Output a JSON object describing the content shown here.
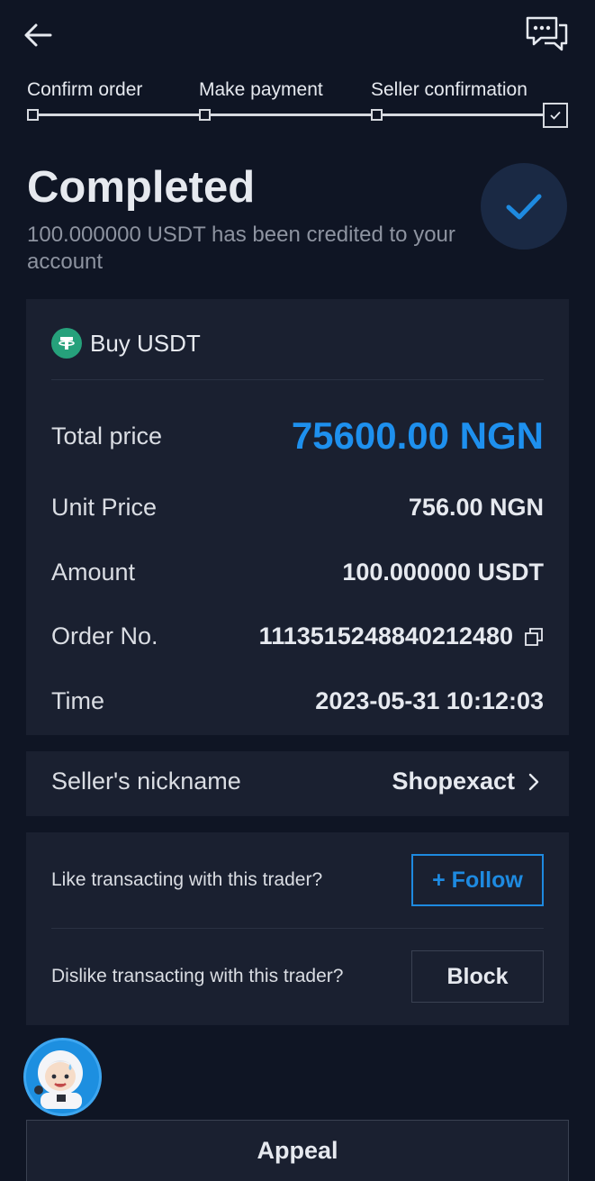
{
  "steps": [
    {
      "label": "Confirm order"
    },
    {
      "label": "Make payment"
    },
    {
      "label": "Seller confirmation"
    }
  ],
  "status": {
    "title": "Completed",
    "subtitle": "100.000000 USDT has been credited to your account"
  },
  "order": {
    "title": "Buy USDT",
    "rows": {
      "total": {
        "label": "Total price",
        "value": "75600.00 NGN"
      },
      "unit_price": {
        "label": "Unit Price",
        "value": "756.00 NGN"
      },
      "amount": {
        "label": "Amount",
        "value": "100.000000 USDT"
      },
      "order_no": {
        "label": "Order No.",
        "value": "1113515248840212480"
      },
      "time": {
        "label": "Time",
        "value": "2023-05-31 10:12:03"
      }
    }
  },
  "seller": {
    "label": "Seller's nickname",
    "name": "Shopexact"
  },
  "trader": {
    "like_question": "Like transacting with this trader?",
    "follow_label": "+ Follow",
    "dislike_question": "Dislike transacting with this trader?",
    "block_label": "Block"
  },
  "appeal_label": "Appeal",
  "colors": {
    "background": "#0f1524",
    "card": "#1a2030",
    "accent": "#1e90ee",
    "tether": "#26a17b"
  },
  "icons": {
    "back": "arrow-left-icon",
    "chat": "chat-bubbles-icon",
    "check": "checkmark-icon",
    "copy": "copy-icon",
    "chevron": "chevron-right-icon",
    "coin": "tether-icon"
  }
}
